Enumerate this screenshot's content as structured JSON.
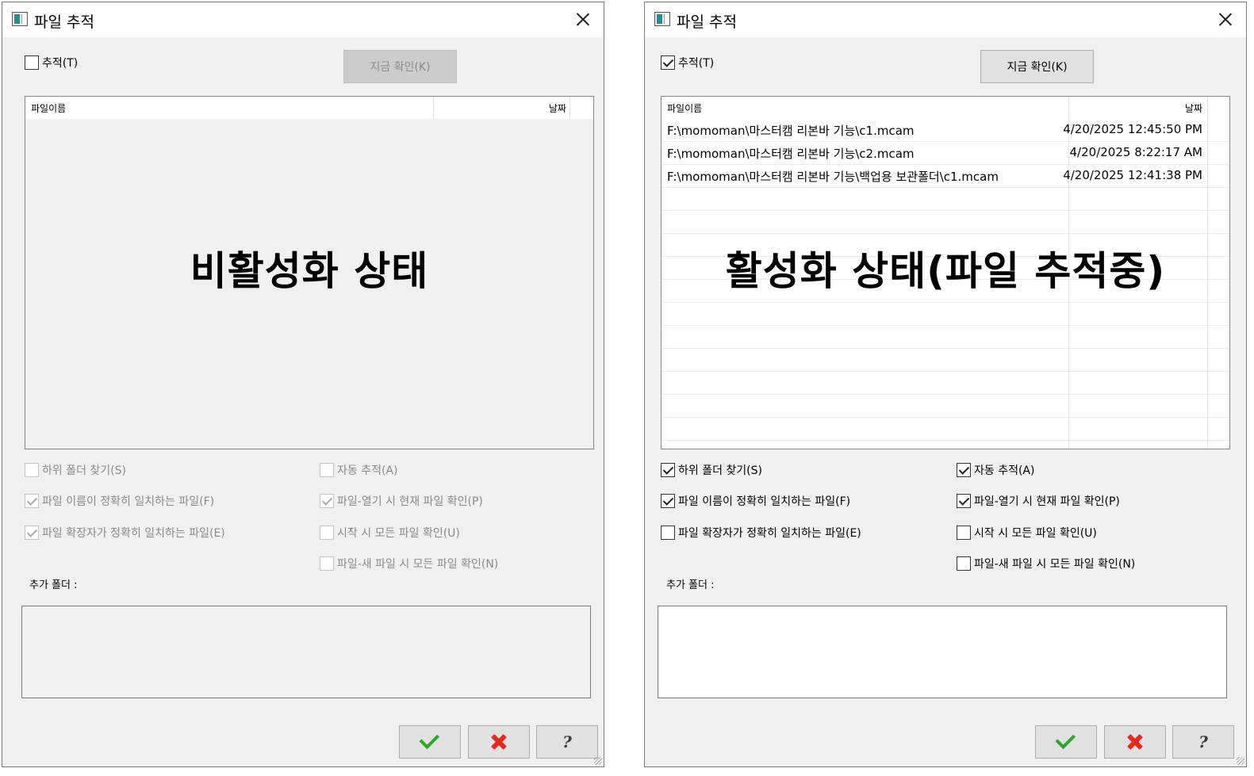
{
  "left": {
    "title": "파일 추적",
    "track_label": "추적(T)",
    "track_checked": false,
    "check_now_label": "지금 확인(K)",
    "columns": {
      "name": "파일이름",
      "date": "날짜"
    },
    "rows": [],
    "overlay": "비활성화 상태",
    "options": {
      "subfolders": {
        "label": "하위 폴더 찾기(S)",
        "checked": false
      },
      "auto_track": {
        "label": "자동 추적(A)",
        "checked": false
      },
      "exact_name": {
        "label": "파일 이름이 정확히 일치하는 파일(F)",
        "checked": true
      },
      "check_on_open": {
        "label": "파일-열기 시 현재 파일 확인(P)",
        "checked": true
      },
      "exact_ext": {
        "label": "파일 확장자가 정확히 일치하는 파일(E)",
        "checked": true
      },
      "check_on_start": {
        "label": "시작 시 모든 파일 확인(U)",
        "checked": false
      },
      "check_on_new": {
        "label": "파일-새 파일 시 모든 파일 확인(N)",
        "checked": false
      }
    },
    "extra_folder_label": "추가 폴더 :"
  },
  "right": {
    "title": "파일 추적",
    "track_label": "추적(T)",
    "track_checked": true,
    "check_now_label": "지금 확인(K)",
    "columns": {
      "name": "파일이름",
      "date": "날짜"
    },
    "rows": [
      {
        "name": "F:\\momoman\\마스터캠 리본바 기능\\c1.mcam",
        "date": "4/20/2025 12:45:50 PM"
      },
      {
        "name": "F:\\momoman\\마스터캠 리본바 기능\\c2.mcam",
        "date": "4/20/2025 8:22:17 AM"
      },
      {
        "name": "F:\\momoman\\마스터캠 리본바 기능\\백업용 보관폴더\\c1.mcam",
        "date": "4/20/2025 12:41:38 PM"
      }
    ],
    "overlay": "활성화 상태(파일 추적중)",
    "options": {
      "subfolders": {
        "label": "하위 폴더 찾기(S)",
        "checked": true
      },
      "auto_track": {
        "label": "자동 추적(A)",
        "checked": true
      },
      "exact_name": {
        "label": "파일 이름이 정확히 일치하는 파일(F)",
        "checked": true
      },
      "check_on_open": {
        "label": "파일-열기 시 현재 파일 확인(P)",
        "checked": true
      },
      "exact_ext": {
        "label": "파일 확장자가 정확히 일치하는 파일(E)",
        "checked": false
      },
      "check_on_start": {
        "label": "시작 시 모든 파일 확인(U)",
        "checked": false
      },
      "check_on_new": {
        "label": "파일-새 파일 시 모든 파일 확인(N)",
        "checked": false
      }
    },
    "extra_folder_label": "추가 폴더 :"
  },
  "footer_icons": [
    "ok-check-icon",
    "cancel-x-icon",
    "help-question-icon"
  ],
  "colors": {
    "ok": "#2ba82b",
    "cancel": "#e02b20",
    "dialog_bg": "#f0f0f0"
  }
}
